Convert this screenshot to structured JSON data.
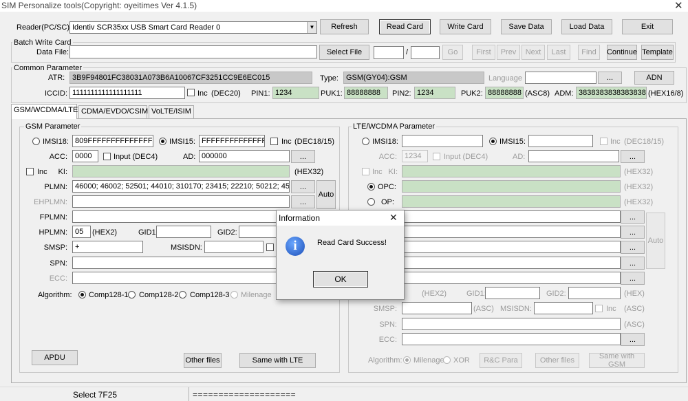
{
  "window": {
    "title": "SIM Personalize tools(Copyright: oyeitimes Ver 4.1.5)"
  },
  "toolbar": {
    "reader_label": "Reader(PC/SC):",
    "reader_value": "Identiv SCR35xx USB Smart Card Reader 0",
    "refresh": "Refresh",
    "read_card": "Read Card",
    "write_card": "Write Card",
    "save_data": "Save Data",
    "load_data": "Load Data",
    "exit": "Exit"
  },
  "batch": {
    "group_title": "Batch Write Card",
    "data_file_label": "Data File:",
    "data_file_value": "",
    "select_file": "Select File",
    "slash": "/",
    "go": "Go",
    "first": "First",
    "prev": "Prev",
    "next": "Next",
    "last": "Last",
    "find": "Find",
    "continue": "Continue",
    "template": "Template"
  },
  "common": {
    "group_title": "Common Parameter",
    "atr_label": "ATR:",
    "atr_value": "3B9F94801FC38031A073B6A10067CF3251CC9E6EC015",
    "type_label": "Type:",
    "type_value": "GSM(GY04):GSM",
    "language_label": "Language",
    "dots": "...",
    "adn": "ADN",
    "iccid_label": "ICCID:",
    "iccid_value": "1111111111111111111",
    "inc_label": "Inc",
    "dec20": "(DEC20)",
    "pin1_label": "PIN1:",
    "pin1_value": "1234",
    "puk1_label": "PUK1:",
    "puk1_value": "88888888",
    "pin2_label": "PIN2:",
    "pin2_value": "1234",
    "puk2_label": "PUK2:",
    "puk2_value": "88888888",
    "asc8": "(ASC8)",
    "adm_label": "ADM:",
    "adm_value": "3838383838383838",
    "hex16_8": "(HEX16/8)"
  },
  "tabs": [
    {
      "label": "GSM/WCDMA/LTE"
    },
    {
      "label": "CDMA/EVDO/CSIM"
    },
    {
      "label": "VoLTE/ISIM"
    }
  ],
  "gsm": {
    "group_title": "GSM Parameter",
    "imsi18_label": "IMSI18:",
    "imsi18_value": "809FFFFFFFFFFFFFFF",
    "imsi15_label": "IMSI15:",
    "imsi15_value": "FFFFFFFFFFFFFFF",
    "inc_label": "Inc",
    "dec18_15": "(DEC18/15)",
    "acc_label": "ACC:",
    "acc_value": "0000",
    "input_dec4": "Input (DEC4)",
    "ad_label": "AD:",
    "ad_value": "000000",
    "dots": "...",
    "ki_label": "KI:",
    "hex32": "(HEX32)",
    "plmn_label": "PLMN:",
    "plmn_value": "46000; 46002; 52501; 44010; 310170; 23415; 22210; 50212; 45501; 2",
    "auto": "Auto",
    "ehplmn_label": "EHPLMN:",
    "fplmn_label": "FPLMN:",
    "hplmn_label": "HPLMN:",
    "hplmn_value": "05",
    "hex2": "(HEX2)",
    "gid1_label": "GID1:",
    "gid2_label": "GID2:",
    "smsp_label": "SMSP:",
    "smsp_value": "+",
    "msisdn_label": "MSISDN:",
    "spn_label": "SPN:",
    "ecc_label": "ECC:",
    "algorithm_label": "Algorithm:",
    "comp128_1": "Comp128-1",
    "comp128_2": "Comp128-2",
    "comp128_3": "Comp128-3",
    "milenage": "Milenage",
    "apdu": "APDU",
    "other_files": "Other files",
    "same_with_lte": "Same with LTE"
  },
  "lte": {
    "group_title": "LTE/WCDMA Parameter",
    "imsi18_label": "IMSI18:",
    "imsi15_label": "IMSI15:",
    "inc_label": "Inc",
    "dec18_15": "(DEC18/15)",
    "acc_label": "ACC:",
    "acc_value": "1234",
    "input_dec4": "Input (DEC4)",
    "ad_label": "AD:",
    "dots": "...",
    "ki_label": "KI:",
    "hex32": "(HEX32)",
    "opc_label": "OPC:",
    "op_label": "OP:",
    "auto": "Auto",
    "hex2": "(HEX2)",
    "gid1_label": "GID1:",
    "gid2_label": "GID2:",
    "hex": "(HEX)",
    "smsp_label": "SMSP:",
    "asc": "(ASC)",
    "msisdn_label": "MSISDN:",
    "spn_label": "SPN:",
    "ecc_label": "ECC:",
    "algorithm_label": "Algorithm:",
    "milenage": "Milenage",
    "xor": "XOR",
    "rc_para": "R&C Para",
    "other_files": "Other files",
    "same_with_gsm": "Same with GSM"
  },
  "dialog": {
    "title": "Information",
    "message": "Read Card Success!",
    "ok": "OK"
  },
  "status": {
    "left": "Select 7F25",
    "right": "===================="
  }
}
